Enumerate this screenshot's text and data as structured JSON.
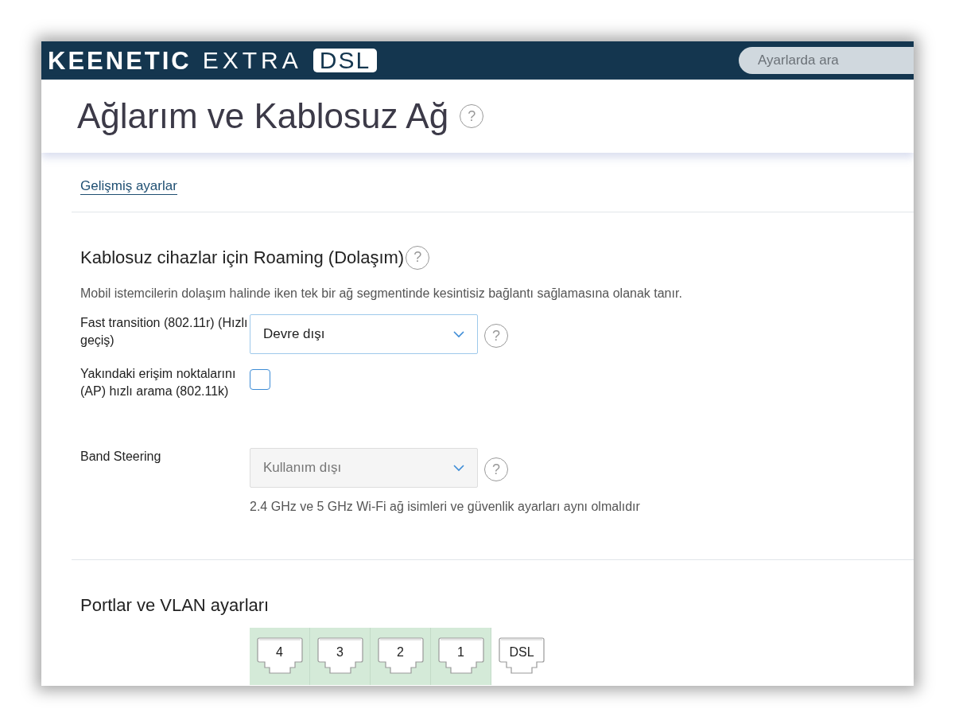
{
  "header": {
    "logo": {
      "brand": "KEENETIC",
      "model": "EXTRA",
      "badge": "DSL"
    },
    "search": {
      "placeholder": "Ayarlarda ara"
    }
  },
  "page": {
    "title": "Ağlarım ve Kablosuz Ağ",
    "help": "?"
  },
  "advanced_link": "Gelişmiş ayarlar",
  "roaming": {
    "title": "Kablosuz cihazlar için Roaming (Dolaşım)",
    "help": "?",
    "description": "Mobil istemcilerin dolaşım halinde iken tek bir ağ segmentinde kesintisiz bağlantı sağlamasına olanak tanır.",
    "fields": [
      {
        "kind": "select",
        "label": "Fast transition (802.11r) (Hızlı geçiş)",
        "value": "Devre dışı",
        "disabled": false,
        "help": "?"
      },
      {
        "kind": "checkbox",
        "label": "Yakındaki erişim noktalarını (AP) hızlı arama (802.11k)",
        "checked": false
      },
      {
        "kind": "select",
        "label": "Band Steering",
        "value": "Kullanım dışı",
        "disabled": true,
        "help": "?",
        "note": "2.4 GHz ve 5 GHz Wi-Fi ağ isimleri ve güvenlik ayarları aynı olmalıdır"
      }
    ]
  },
  "ports": {
    "title": "Portlar ve VLAN ayarları",
    "items": [
      {
        "label": "4",
        "selected": true
      },
      {
        "label": "3",
        "selected": true
      },
      {
        "label": "2",
        "selected": true
      },
      {
        "label": "1",
        "selected": true
      },
      {
        "label": "DSL",
        "selected": false
      }
    ]
  }
}
